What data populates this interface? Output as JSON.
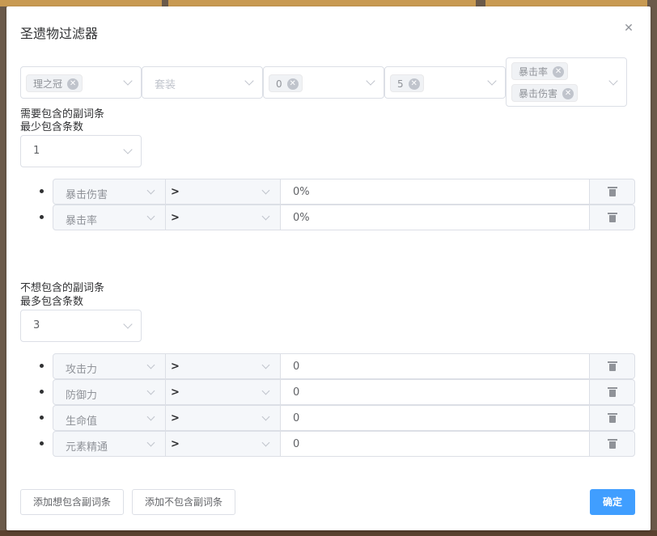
{
  "dialog": {
    "title": "圣遗物过滤器"
  },
  "filters": {
    "position_tag": "理之冠",
    "set_placeholder": "套装",
    "level_min_tag": "0",
    "level_max_tag": "5",
    "main_stat_tags": [
      "暴击率",
      "暴击伤害"
    ]
  },
  "include": {
    "title": "需要包含的副词条",
    "min_label": "最少包含条数",
    "min_value": "1",
    "rows": [
      {
        "stat": "暴击伤害",
        "op": ">",
        "value": "0%"
      },
      {
        "stat": "暴击率",
        "op": ">",
        "value": "0%"
      }
    ]
  },
  "exclude": {
    "title": "不想包含的副词条",
    "max_label": "最多包含条数",
    "max_value": "3",
    "rows": [
      {
        "stat": "攻击力",
        "op": ">",
        "value": "0"
      },
      {
        "stat": "防御力",
        "op": ">",
        "value": "0"
      },
      {
        "stat": "生命值",
        "op": ">",
        "value": "0"
      },
      {
        "stat": "元素精通",
        "op": ">",
        "value": "0"
      }
    ]
  },
  "footer": {
    "add_include_label": "添加想包含副词条",
    "add_exclude_label": "添加不包含副词条",
    "confirm_label": "确定"
  },
  "colors": {
    "primary": "#409eff",
    "backdrop": "#6b5a4a"
  },
  "icons": {
    "close": "close-icon",
    "delete": "trash-icon",
    "dropdown": "chevron-down-icon"
  }
}
